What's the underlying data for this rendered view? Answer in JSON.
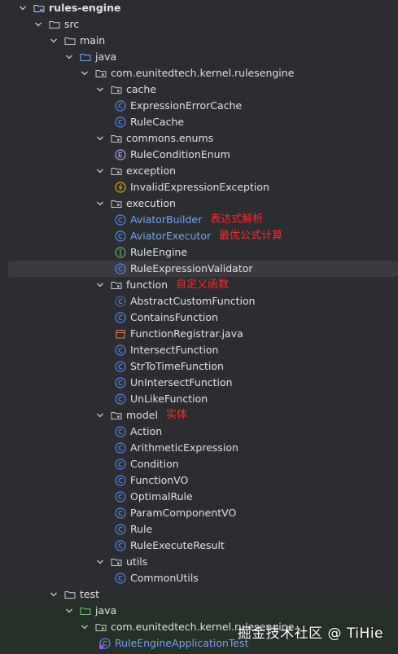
{
  "tree": [
    {
      "label": "rules-engine",
      "depth": 0,
      "kind": "module",
      "bold": true
    },
    {
      "label": "src",
      "depth": 1,
      "kind": "folder"
    },
    {
      "label": "main",
      "depth": 2,
      "kind": "folder"
    },
    {
      "label": "java",
      "depth": 3,
      "kind": "src-folder"
    },
    {
      "label": "com.eunitedtech.kernel.rulesengine",
      "depth": 4,
      "kind": "package"
    },
    {
      "label": "cache",
      "depth": 5,
      "kind": "package"
    },
    {
      "label": "ExpressionErrorCache",
      "depth": 6,
      "kind": "class"
    },
    {
      "label": "RuleCache",
      "depth": 6,
      "kind": "class"
    },
    {
      "label": "commons.enums",
      "depth": 5,
      "kind": "package"
    },
    {
      "label": "RuleConditionEnum",
      "depth": 6,
      "kind": "enum"
    },
    {
      "label": "exception",
      "depth": 5,
      "kind": "package"
    },
    {
      "label": "InvalidExpressionException",
      "depth": 6,
      "kind": "exception"
    },
    {
      "label": "execution",
      "depth": 5,
      "kind": "package"
    },
    {
      "label": "AviatorBuilder",
      "depth": 6,
      "kind": "class",
      "blue": true,
      "note": "表达式解析"
    },
    {
      "label": "AviatorExecutor",
      "depth": 6,
      "kind": "class",
      "blue": true,
      "note": "最优公式计算"
    },
    {
      "label": "RuleEngine",
      "depth": 6,
      "kind": "interface"
    },
    {
      "label": "RuleExpressionValidator",
      "depth": 6,
      "kind": "class",
      "selected": true
    },
    {
      "label": "function",
      "depth": 5,
      "kind": "package",
      "note": "自定义函数"
    },
    {
      "label": "AbstractCustomFunction",
      "depth": 6,
      "kind": "abstract"
    },
    {
      "label": "ContainsFunction",
      "depth": 6,
      "kind": "class"
    },
    {
      "label": "FunctionRegistrar.java",
      "depth": 6,
      "kind": "java-file"
    },
    {
      "label": "IntersectFunction",
      "depth": 6,
      "kind": "class"
    },
    {
      "label": "StrToTimeFunction",
      "depth": 6,
      "kind": "class"
    },
    {
      "label": "UnIntersectFunction",
      "depth": 6,
      "kind": "class"
    },
    {
      "label": "UnLikeFunction",
      "depth": 6,
      "kind": "class"
    },
    {
      "label": "model",
      "depth": 5,
      "kind": "package",
      "note": "实体"
    },
    {
      "label": "Action",
      "depth": 6,
      "kind": "class"
    },
    {
      "label": "ArithmeticExpression",
      "depth": 6,
      "kind": "class"
    },
    {
      "label": "Condition",
      "depth": 6,
      "kind": "class"
    },
    {
      "label": "FunctionVO",
      "depth": 6,
      "kind": "class"
    },
    {
      "label": "OptimalRule",
      "depth": 6,
      "kind": "class"
    },
    {
      "label": "ParamComponentVO",
      "depth": 6,
      "kind": "class"
    },
    {
      "label": "Rule",
      "depth": 6,
      "kind": "class"
    },
    {
      "label": "RuleExecuteResult",
      "depth": 6,
      "kind": "class"
    },
    {
      "label": "utils",
      "depth": 5,
      "kind": "package"
    },
    {
      "label": "CommonUtils",
      "depth": 6,
      "kind": "class"
    },
    {
      "label": "test",
      "depth": 2,
      "kind": "folder"
    },
    {
      "label": "java",
      "depth": 3,
      "kind": "test-folder"
    },
    {
      "label": "com.eunitedtech.kernel.rulesengine",
      "depth": 4,
      "kind": "package"
    },
    {
      "label": "RuleEngineApplicationTest",
      "depth": 5,
      "kind": "test-class",
      "blue": true
    }
  ],
  "watermark": "掘金技术社区 @ TiHie",
  "colors": {
    "background": "#2b2d30",
    "text": "#dfe1e5",
    "modified_blue": "#6fa6f0",
    "annotation_red": "#ff2a2a",
    "class_icon": "#548af7",
    "enum_icon": "#b99bf8",
    "exception_icon": "#e5a50a",
    "interface_icon": "#5fb85f",
    "selection": "#393b40"
  }
}
